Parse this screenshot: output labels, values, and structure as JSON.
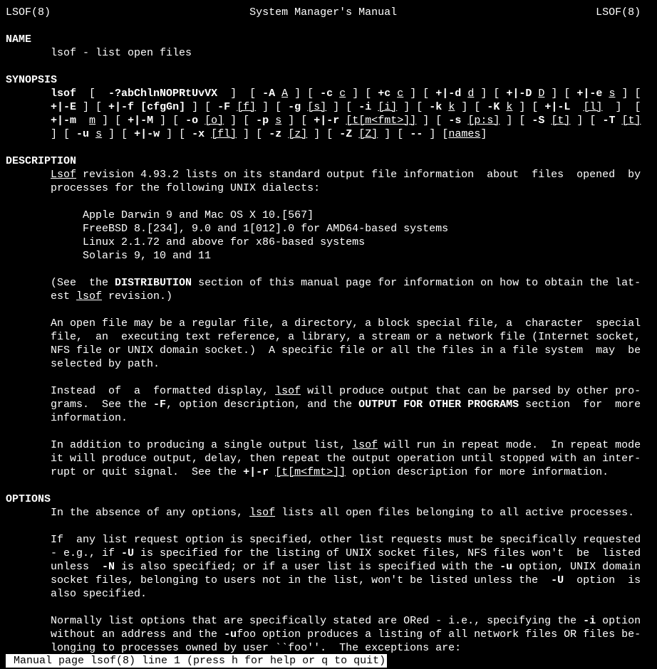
{
  "header": {
    "left": "LSOF(8)",
    "center": "System Manager's Manual",
    "right": "LSOF(8)"
  },
  "name": {
    "heading": "NAME",
    "line": "       lsof - list open files"
  },
  "synopsis": {
    "heading": "SYNOPSIS",
    "cmd": "lsof",
    "flags_block": "-?abChlnNOPRtUvVX",
    "opts": {
      "A": {
        "flag": "-A",
        "arg": "A"
      },
      "c": {
        "flag": "-c",
        "arg": "c"
      },
      "plus_c": {
        "flag": "+c",
        "arg": "c"
      },
      "d": {
        "flag": "+|-d",
        "arg": "d"
      },
      "D": {
        "flag": "+|-D",
        "arg": "D"
      },
      "e": {
        "flag": "+|-e",
        "arg": "s"
      },
      "E": {
        "flag": "+|-E"
      },
      "f": {
        "flag": "+|-f",
        "arg": "[cfgGn]"
      },
      "F": {
        "flag": "-F",
        "arg": "[f]"
      },
      "g": {
        "flag": "-g",
        "arg": "[s]"
      },
      "i": {
        "flag": "-i",
        "arg": "[i]"
      },
      "k": {
        "flag": "-k",
        "arg": "k"
      },
      "K": {
        "flag": "-K",
        "arg": "k"
      },
      "L": {
        "flag": "+|-L",
        "arg": "[l]"
      },
      "m": {
        "flag": "+|-m",
        "arg": "m"
      },
      "M": {
        "flag": "+|-M"
      },
      "o": {
        "flag": "-o",
        "arg": "[o]"
      },
      "p": {
        "flag": "-p",
        "arg": "s"
      },
      "r": {
        "flag": "+|-r",
        "arg": "[t[m<fmt>]]"
      },
      "s": {
        "flag": "-s",
        "arg": "[p:s]"
      },
      "S": {
        "flag": "-S",
        "arg": "[t]"
      },
      "T": {
        "flag": "-T",
        "arg": "[t]"
      },
      "u": {
        "flag": "-u",
        "arg": "s"
      },
      "w": {
        "flag": "+|-w"
      },
      "x": {
        "flag": "-x",
        "arg": "[fl]"
      },
      "z": {
        "flag": "-z",
        "arg": "[z]"
      },
      "Z": {
        "flag": "-Z",
        "arg": "[Z]"
      },
      "dashdash": "--",
      "names": "names"
    }
  },
  "description": {
    "heading": "DESCRIPTION",
    "p1_a": "Lsof",
    "p1_b": " revision 4.93.2 lists on its standard output file information  about  files  opened  by",
    "p1_c": "       processes for the following UNIX dialects:",
    "dialects": [
      "            Apple Darwin 9 and Mac OS X 10.[567]",
      "            FreeBSD 8.[234], 9.0 and 1[012].0 for AMD64-based systems",
      "            Linux 2.1.72 and above for x86-based systems",
      "            Solaris 9, 10 and 11"
    ],
    "p2_a": "       (See  the ",
    "p2_b": "DISTRIBUTION",
    "p2_c": " section of this manual page for information on how to obtain the lat-",
    "p2_d": "       est ",
    "p2_e": "lsof",
    "p2_f": " revision.)",
    "p3": [
      "       An open file may be a regular file, a directory, a block special file, a  character  special",
      "       file,  an  executing text reference, a library, a stream or a network file (Internet socket,",
      "       NFS file or UNIX domain socket.)  A specific file or all the files in a file system  may  be",
      "       selected by path."
    ],
    "p4_a": "       Instead  of  a  formatted display, ",
    "p4_b": "lsof",
    "p4_c": " will produce output that can be parsed by other pro-",
    "p4_d": "       grams.  See the ",
    "p4_e": "-F",
    "p4_f": ", option description, and the ",
    "p4_g": "OUTPUT FOR OTHER PROGRAMS",
    "p4_h": " section  for  more",
    "p4_i": "       information.",
    "p5_a": "       In addition to producing a single output list, ",
    "p5_b": "lsof",
    "p5_c": " will run in repeat mode.  In repeat mode",
    "p5_d": "       it will produce output, delay, then repeat the output operation until stopped with an inter-",
    "p5_e": "       rupt or quit signal.  See the ",
    "p5_f": "+|-r",
    "p5_g": " ",
    "p5_h": "[t[m<fmt>]]",
    "p5_i": " option description for more information."
  },
  "options": {
    "heading": "OPTIONS",
    "p1_a": "       In the absence of any options, ",
    "p1_b": "lsof",
    "p1_c": " lists all open files belonging to all active processes.",
    "p2_a": "       If  any list request option is specified, other list requests must be specifically requested",
    "p2_b": "       - e.g., if ",
    "p2_c": "-U",
    "p2_d": " is specified for the listing of UNIX socket files, NFS files won't  be  listed",
    "p2_e": "       unless  ",
    "p2_f": "-N",
    "p2_g": " is also specified; or if a user list is specified with the ",
    "p2_h": "-u",
    "p2_i": " option, UNIX domain",
    "p2_j": "       socket files, belonging to users not in the list, won't be listed unless the  ",
    "p2_k": "-U",
    "p2_l": "  option  is",
    "p2_m": "       also specified.",
    "p3_a": "       Normally list options that are specifically stated are ORed - i.e., specifying the ",
    "p3_b": "-i",
    "p3_c": " option",
    "p3_d": "       without an address and the ",
    "p3_e": "-u",
    "p3_f": "foo option produces a listing of all network files OR files be-",
    "p3_g": "       longing to processes owned by user ``foo''.  The exceptions are:"
  },
  "statusbar": " Manual page lsof(8) line 1 (press h for help or q to quit)"
}
